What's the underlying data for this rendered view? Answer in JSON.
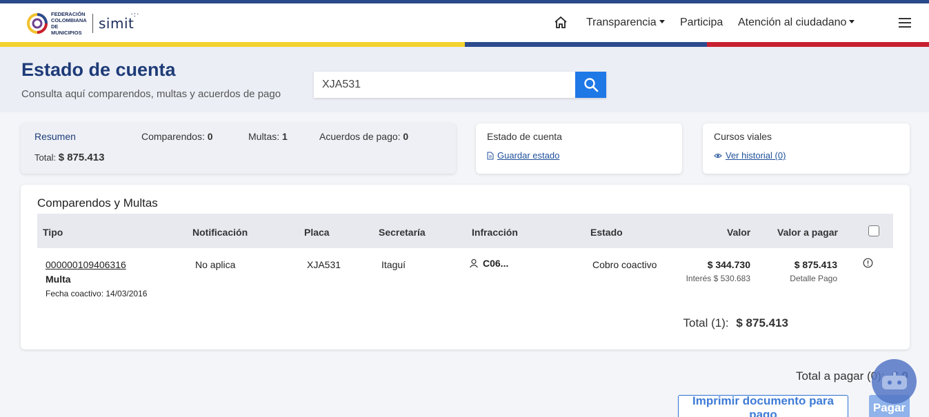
{
  "header": {
    "logo_fcm_text": "FEDERACIÓN COLOMBIANA DE MUNICIPIOS",
    "logo_simit": "simit",
    "nav": {
      "transparencia": "Transparencia",
      "participa": "Participa",
      "atencion": "Atención al ciudadano"
    },
    "icons": [
      "home-icon",
      "caret-down-icon",
      "hamburger-menu-icon"
    ]
  },
  "hero": {
    "title": "Estado de cuenta",
    "subtitle": "Consulta aquí comparendos, multas y acuerdos de pago",
    "search_value": "XJA531"
  },
  "resumen": {
    "label": "Resumen",
    "comparendos_label": "Comparendos:",
    "comparendos_value": "0",
    "multas_label": "Multas:",
    "multas_value": "1",
    "acuerdos_label": "Acuerdos de pago:",
    "acuerdos_value": "0",
    "total_label": "Total:",
    "total_value": "$ 875.413"
  },
  "estado_card": {
    "title": "Estado de cuenta",
    "link": "Guardar estado",
    "icon": "document-icon"
  },
  "cursos_card": {
    "title": "Cursos viales",
    "link": "Ver historial (0)",
    "icon": "eye-icon"
  },
  "table": {
    "title": "Comparendos y Multas",
    "headers": {
      "tipo": "Tipo",
      "notificacion": "Notificación",
      "placa": "Placa",
      "secretaria": "Secretaría",
      "infraccion": "Infracción",
      "estado": "Estado",
      "valor": "Valor",
      "valor_pagar": "Valor a pagar"
    },
    "rows": [
      {
        "numero": "000000109406316",
        "tipo": "Multa",
        "fecha_coactivo": "Fecha coactivo: 14/03/2016",
        "notificacion": "No aplica",
        "placa": "XJA531",
        "secretaria": "Itaguí",
        "infraccion": "C06...",
        "estado": "Cobro coactivo",
        "valor": "$ 344.730",
        "interes": "Interés $ 530.683",
        "valor_pagar": "$ 875.413",
        "detalle": "Detalle Pago"
      }
    ],
    "total_label": "Total (1):",
    "total_value": "$ 875.413"
  },
  "footer": {
    "total_pagar_label": "Total a pagar (0):",
    "total_pagar_value": "$ 0",
    "print_button": "Imprimir documento para pago",
    "pay_button": "Pagar"
  },
  "colors": {
    "brand_blue": "#1e3b78",
    "search_button": "#1e78e6",
    "flag_yellow": "#f2d22e",
    "flag_blue": "#2c4b8e",
    "flag_red": "#c8202f"
  }
}
